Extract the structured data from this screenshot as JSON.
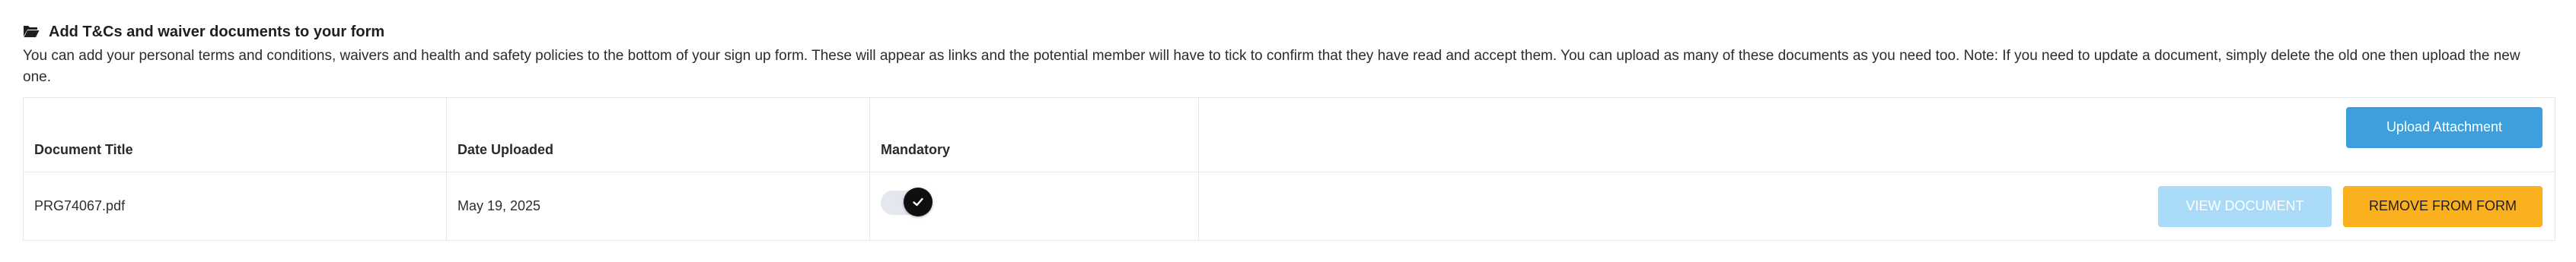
{
  "section": {
    "title": "Add T&Cs and waiver documents to your form",
    "title_icon": "folder-open-icon",
    "description": "You can add your personal terms and conditions, waivers and health and safety policies to the bottom of your sign up form. These will appear as links and the potential member will have to tick to confirm that they have read and accept them. You can upload as many of these documents as you need too. Note: If you need to update a document, simply delete the old one then upload the new one."
  },
  "table": {
    "columns": [
      "Document Title",
      "Date Uploaded",
      "Mandatory"
    ],
    "upload_label": "Upload Attachment",
    "rows": [
      {
        "title": "PRG74067.pdf",
        "date": "May 19, 2025",
        "mandatory": true,
        "view_label": "VIEW DOCUMENT",
        "remove_label": "REMOVE FROM FORM"
      }
    ]
  },
  "colors": {
    "upload_button": "#3d9fdc",
    "view_button": "#a9dbf8",
    "remove_button": "#fbb11e",
    "toggle_knob": "#0f0f0f"
  }
}
